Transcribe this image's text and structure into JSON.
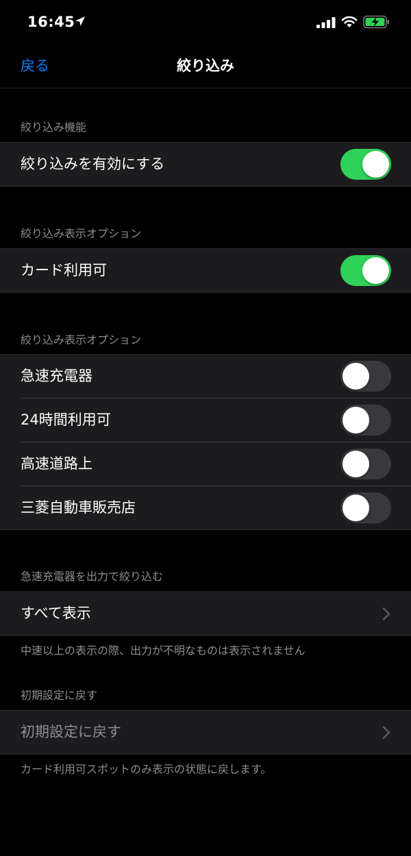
{
  "status_bar": {
    "time": "16:45",
    "icons": [
      "location-arrow-icon",
      "cellular-signal-icon",
      "wifi-icon",
      "battery-charging-icon"
    ]
  },
  "nav": {
    "back_label": "戻る",
    "title": "絞り込み"
  },
  "sections": [
    {
      "header": "絞り込み機能",
      "rows": [
        {
          "label": "絞り込みを有効にする",
          "toggle": true
        }
      ]
    },
    {
      "header": "絞り込み表示オプション",
      "rows": [
        {
          "label": "カード利用可",
          "toggle": true
        }
      ]
    },
    {
      "header": "絞り込み表示オプション",
      "rows": [
        {
          "label": "急速充電器",
          "toggle": false
        },
        {
          "label": "24時間利用可",
          "toggle": false
        },
        {
          "label": "高速道路上",
          "toggle": false
        },
        {
          "label": "三菱自動車販売店",
          "toggle": false
        }
      ]
    },
    {
      "header": "急速充電器を出力で絞り込む",
      "rows": [
        {
          "label": "すべて表示"
        }
      ],
      "footer": "中速以上の表示の際、出力が不明なものは表示されません"
    },
    {
      "header": "初期設定に戻す",
      "rows": [
        {
          "label": "初期設定に戻す"
        }
      ],
      "footer": "カード利用可スポットのみ表示の状態に戻します。"
    }
  ],
  "colors": {
    "accent": "#0a84ff",
    "toggle_on": "#30d158",
    "toggle_off": "#39393d",
    "background": "#000000",
    "cell": "#1c1c1e",
    "secondary_text": "#8d8d93"
  }
}
